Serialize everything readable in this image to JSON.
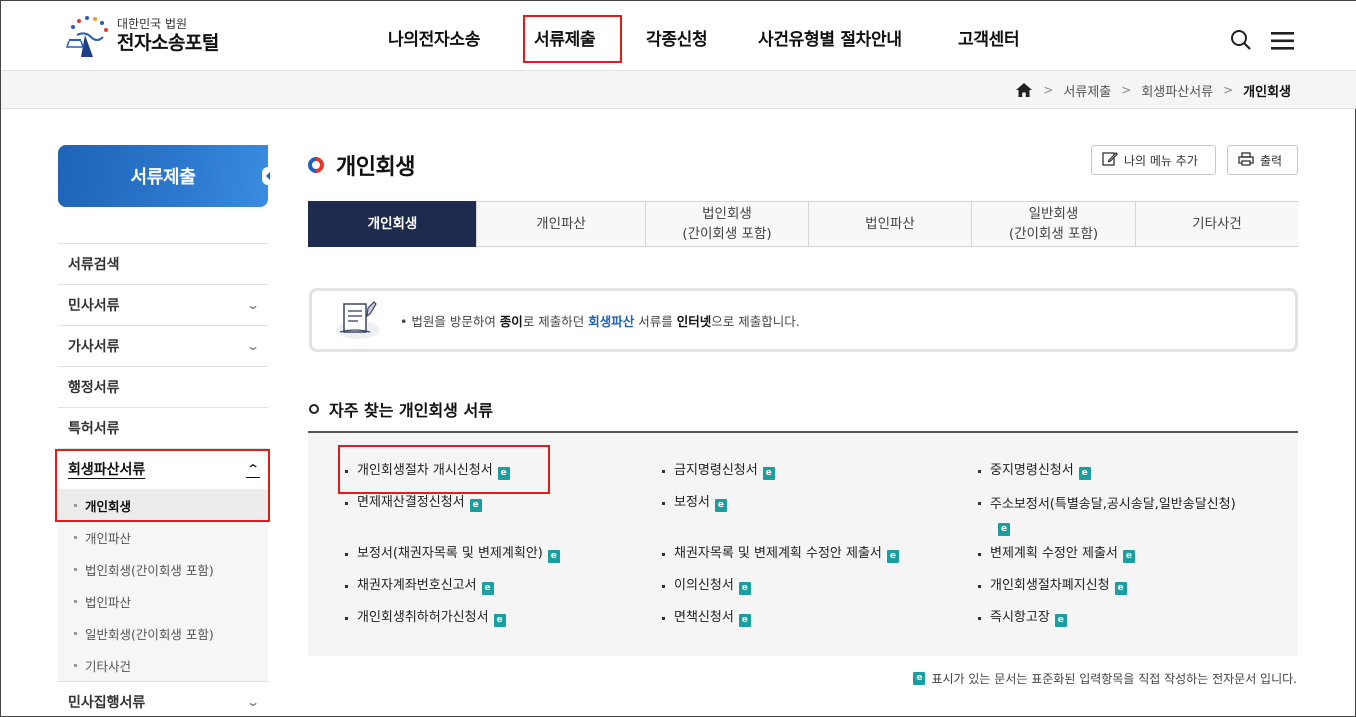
{
  "header": {
    "logo_sub": "대한민국 법원",
    "logo_main": "전자소송포털",
    "nav": [
      {
        "label": "나의전자소송"
      },
      {
        "label": "서류제출"
      },
      {
        "label": "각종신청"
      },
      {
        "label": "사건유형별 절차안내"
      },
      {
        "label": "고객센터"
      }
    ],
    "search_icon": "search-icon",
    "menu_icon": "hamburger-menu-icon"
  },
  "breadcrumb": {
    "items": [
      "서류제출",
      "회생파산서류"
    ],
    "current": "개인회생"
  },
  "sidebar": {
    "title": "서류제출",
    "items": [
      {
        "label": "서류검색",
        "chevron": ""
      },
      {
        "label": "민사서류",
        "chevron": "⌄"
      },
      {
        "label": "가사서류",
        "chevron": "⌄"
      },
      {
        "label": "행정서류",
        "chevron": ""
      },
      {
        "label": "특허서류",
        "chevron": ""
      },
      {
        "label": "회생파산서류",
        "chevron": "⌃"
      }
    ],
    "sub_items": [
      "개인회생",
      "개인파산",
      "법인회생(간이회생 포함)",
      "법인파산",
      "일반회생(간이회생 포함)",
      "기타사건"
    ],
    "last_item": {
      "label": "민사집행서류",
      "chevron": "⌄"
    }
  },
  "main": {
    "title": "개인회생",
    "btn_add_menu": "나의 메뉴 추가",
    "btn_print": "출력",
    "tabs": [
      "개인회생",
      "개인파산",
      "법인회생\n(간이회생 포함)",
      "법인파산",
      "일반회생\n(간이회생 포함)",
      "기타사건"
    ],
    "notice": {
      "prefix": "• 법원을 방문하여 ",
      "paper": "종이",
      "mid1": "로 제출하던 ",
      "rehab": "회생파산",
      "mid2": " 서류를 ",
      "internet": "인터넷",
      "suffix": "으로 제출합니다."
    },
    "section_title": "자주 찾는 개인회생 서류",
    "documents": [
      [
        "개인회생절차 개시신청서",
        "금지명령신청서",
        "중지명령신청서"
      ],
      [
        "면제재산결정신청서",
        "보정서",
        "주소보정서(특별송달,공시송달,일반송달신청)"
      ],
      [
        "보정서(채권자목록 및 변제계획안)",
        "채권자목록 및 변제계획 수정안 제출서",
        "변제계획 수정안 제출서"
      ],
      [
        "채권자계좌번호신고서",
        "이의신청서",
        "개인회생절차폐지신청"
      ],
      [
        "개인회생취하허가신청서",
        "면책신청서",
        "즉시항고장"
      ]
    ],
    "e_badge": "e",
    "legend": "표시가 있는 문서는 표준화된 입력항목을 직접 작성하는 전자문서 입니다."
  }
}
